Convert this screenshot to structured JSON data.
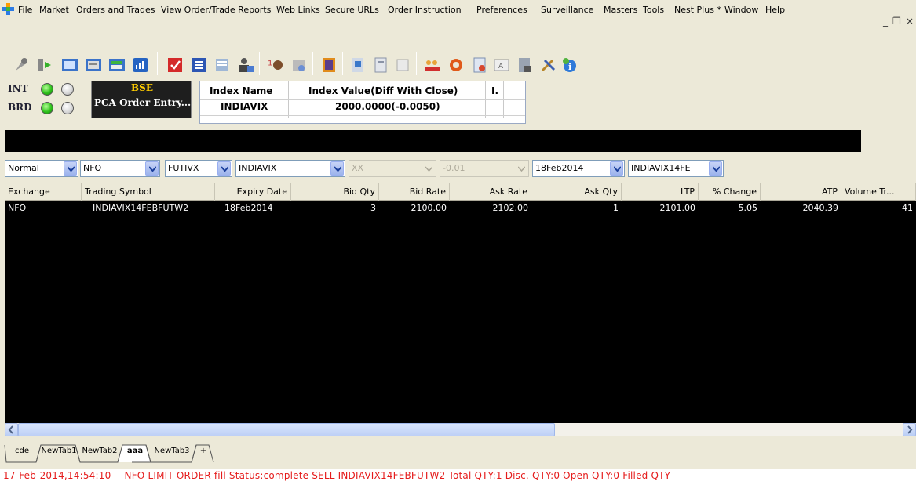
{
  "menu": {
    "items": [
      "File",
      "Market",
      "Orders and Trades",
      "View Order/Trade Reports",
      "Web Links",
      "Secure URLs",
      "Order Instruction",
      "Preferences",
      "Surveillance",
      "Masters",
      "Tools",
      "Nest Plus *",
      "Window",
      "Help"
    ]
  },
  "window_controls": {
    "minimize": "_",
    "restore": "❐",
    "close": "×"
  },
  "toolbar": {
    "icons": [
      "tool-icon",
      "transfer-icon",
      "market-watch-icon",
      "order-book-icon",
      "trade-book-icon",
      "chart-icon",
      "buy-sell-icon",
      "list-icon",
      "report-icon",
      "user-icon",
      "time-icon",
      "print-icon",
      "notes-icon",
      "book-icon",
      "doc-icon",
      "blank-icon",
      "users-group-icon",
      "refresh-icon",
      "file-icon",
      "edit-icon",
      "settings-doc-icon",
      "tools-icon",
      "info-icon"
    ]
  },
  "status": {
    "int_label": "INT",
    "brd_label": "BRD",
    "exchange_title": "BSE",
    "exchange_sub": "PCA Order Entry..."
  },
  "index": {
    "headers": [
      "Index Name",
      "Index Value(Diff With Close)",
      "I."
    ],
    "name": "INDIAVIX",
    "value": "2000.0000(-0.0050)"
  },
  "filters": {
    "mode": "Normal",
    "exchange": "NFO",
    "instrument": "FUTIVX",
    "symbol": "INDIAVIX",
    "option_type": "XX",
    "strike": "-0.01",
    "expiry": "18Feb2014",
    "contract": "INDIAVIX14FE"
  },
  "table": {
    "columns": [
      "Exchange",
      "Trading Symbol",
      "Expiry Date",
      "Bid Qty",
      "Bid Rate",
      "Ask Rate",
      "Ask Qty",
      "LTP",
      "% Change",
      "ATP",
      "Volume Tr..."
    ],
    "rows": [
      [
        "NFO",
        "INDIAVIX14FEBFUTW2",
        "18Feb2014",
        "3",
        "2100.00",
        "2102.00",
        "1",
        "2101.00",
        "5.05",
        "2040.39",
        "41"
      ]
    ]
  },
  "tabs": [
    "cde",
    "NewTab1",
    "NewTab2",
    "aaa",
    "NewTab3",
    "+"
  ],
  "active_tab": "aaa",
  "status_message": "17-Feb-2014,14:54:10 -- NFO LIMIT ORDER fill Status:complete  SELL  INDIAVIX14FEBFUTW2  Total QTY:1   Disc. QTY:0   Open QTY:0   Filled QTY",
  "colors": {
    "status_text": "#e51c1c",
    "grid_bg": "#000000",
    "exchange_title": "#ffcc00"
  }
}
